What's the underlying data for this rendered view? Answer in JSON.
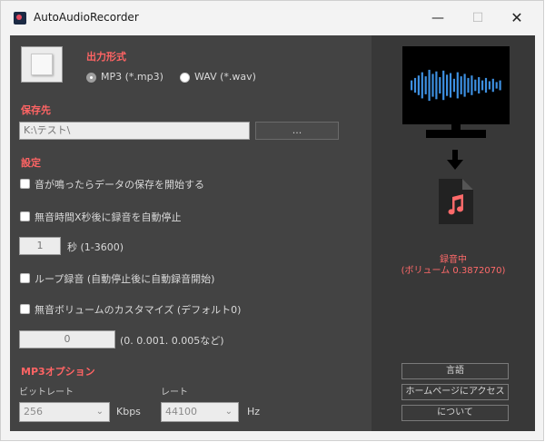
{
  "window": {
    "title": "AutoAudioRecorder",
    "minimize": "—",
    "maximize": "☐",
    "close": "✕"
  },
  "output_format": {
    "heading": "出力形式",
    "options": [
      {
        "label": "MP3 (*.mp3)",
        "selected": true
      },
      {
        "label": "WAV (*.wav)",
        "selected": false
      }
    ]
  },
  "save_dest": {
    "heading": "保存先",
    "path_value": "K:\\テスト\\",
    "browse_label": "..."
  },
  "settings": {
    "heading": "設定",
    "start_on_sound": "音が鳴ったらデータの保存を開始する",
    "auto_stop_on_silence": "無音時間X秒後に録音を自動停止",
    "seconds_value": "1",
    "seconds_unit": "秒 (1-3600)",
    "loop_recording": "ループ録音 (自動停止後に自動録音開始)",
    "custom_silence_volume": "無音ボリュームのカスタマイズ (デフォルト0)",
    "silence_value": "0",
    "silence_hint": "(0. 0.001. 0.005など)"
  },
  "mp3_options": {
    "heading": "MP3オプション",
    "bitrate_label": "ビットレート",
    "bitrate_value": "256",
    "bitrate_unit": "Kbps",
    "rate_label": "レート",
    "rate_value": "44100",
    "rate_unit": "Hz"
  },
  "status": {
    "recording": "録音中",
    "volume": "(ボリューム 0.3872070)"
  },
  "right_buttons": {
    "language": "言語",
    "homepage": "ホームページにアクセス",
    "about": "について"
  },
  "colors": {
    "accent_red": "#ff6464",
    "wave_blue": "#3d8fe0",
    "panel_dark": "#434343"
  },
  "waveform_levels": [
    0.3,
    0.45,
    0.6,
    0.8,
    0.55,
    0.95,
    0.7,
    0.85,
    0.5,
    0.9,
    0.65,
    0.75,
    0.4,
    0.8,
    0.55,
    0.7,
    0.45,
    0.6,
    0.35,
    0.5,
    0.3,
    0.45,
    0.25,
    0.4,
    0.2,
    0.3
  ]
}
